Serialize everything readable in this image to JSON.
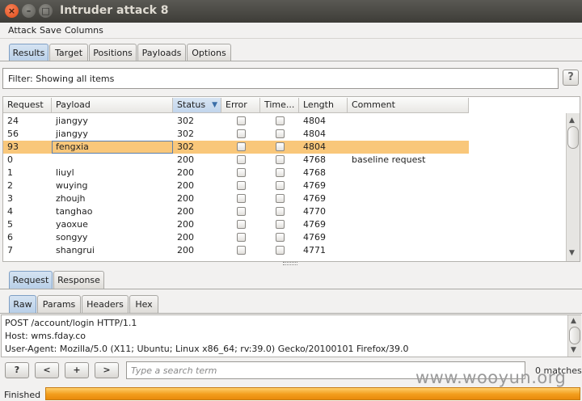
{
  "window": {
    "title": "Intruder attack 8"
  },
  "menu": [
    "Attack",
    "Save",
    "Columns"
  ],
  "main_tabs": [
    "Results",
    "Target",
    "Positions",
    "Payloads",
    "Options"
  ],
  "filter": {
    "text": "Filter:  Showing all items",
    "help": "?"
  },
  "table": {
    "columns": [
      "Request",
      "Payload",
      "Status",
      "Error",
      "Time...",
      "Length",
      "Comment"
    ],
    "sorted_column": "Status",
    "rows": [
      {
        "request": "24",
        "payload": "jiangyy",
        "status": "302",
        "length": "4804",
        "comment": ""
      },
      {
        "request": "56",
        "payload": "jiangyy",
        "status": "302",
        "length": "4804",
        "comment": ""
      },
      {
        "request": "93",
        "payload": "fengxia",
        "status": "302",
        "length": "4804",
        "comment": "",
        "selected": true
      },
      {
        "request": "0",
        "payload": "",
        "status": "200",
        "length": "4768",
        "comment": "baseline request"
      },
      {
        "request": "1",
        "payload": "liuyl",
        "status": "200",
        "length": "4768",
        "comment": ""
      },
      {
        "request": "2",
        "payload": "wuying",
        "status": "200",
        "length": "4769",
        "comment": ""
      },
      {
        "request": "3",
        "payload": "zhoujh",
        "status": "200",
        "length": "4769",
        "comment": ""
      },
      {
        "request": "4",
        "payload": "tanghao",
        "status": "200",
        "length": "4770",
        "comment": ""
      },
      {
        "request": "5",
        "payload": "yaoxue",
        "status": "200",
        "length": "4769",
        "comment": ""
      },
      {
        "request": "6",
        "payload": "songyy",
        "status": "200",
        "length": "4769",
        "comment": ""
      },
      {
        "request": "7",
        "payload": "shangrui",
        "status": "200",
        "length": "4771",
        "comment": ""
      }
    ]
  },
  "detail_tabs": [
    "Request",
    "Response"
  ],
  "view_tabs": [
    "Raw",
    "Params",
    "Headers",
    "Hex"
  ],
  "raw_lines": [
    "POST /account/login HTTP/1.1",
    "Host: wms.fday.co",
    "User-Agent: Mozilla/5.0 (X11; Ubuntu; Linux x86_64; rv:39.0) Gecko/20100101 Firefox/39.0"
  ],
  "search": {
    "buttons": [
      "?",
      "<",
      "+",
      ">"
    ],
    "placeholder": "Type a search term",
    "matches": "0 matches"
  },
  "status": {
    "text": "Finished",
    "progress": 1.0
  },
  "watermark": "www.wooyun.org",
  "colors": {
    "selected_row": "#f9c77a",
    "active_tab": "#c6d9ef",
    "progress": "#f29d1c"
  }
}
